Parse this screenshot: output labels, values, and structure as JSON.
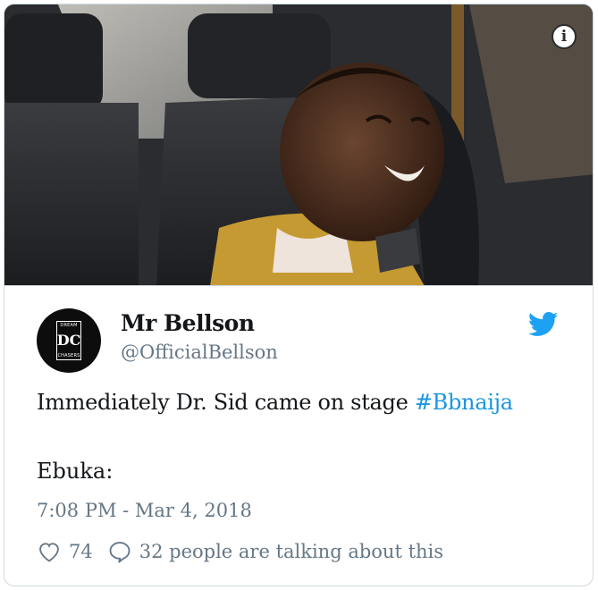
{
  "media": {
    "alt_icon": "photo-of-smiling-child-in-car-seat",
    "info_icon": "info-icon",
    "info_glyph": "i"
  },
  "user": {
    "display_name": "Mr Bellson",
    "handle": "@OfficialBellson",
    "avatar_icon": "dream-chasers-logo",
    "avatar_text_top": "DREAM",
    "avatar_text_mid": "DC",
    "avatar_text_bottom": "CHASERS"
  },
  "brand": {
    "icon": "twitter-bird-icon",
    "color": "#1da1f2"
  },
  "tweet": {
    "text": "Immediately Dr. Sid came on stage ",
    "hashtag": "#Bbnaija",
    "text_2": "Ebuka:",
    "timestamp": "7:08 PM - Mar 4, 2018"
  },
  "actions": {
    "like_icon": "heart-icon",
    "like_count": "74",
    "reply_icon": "speech-bubble-icon",
    "talking_text": "32 people are talking about this"
  },
  "colors": {
    "text": "#14171a",
    "muted": "#657786",
    "link": "#1b95e0",
    "border": "#cfd9de"
  }
}
